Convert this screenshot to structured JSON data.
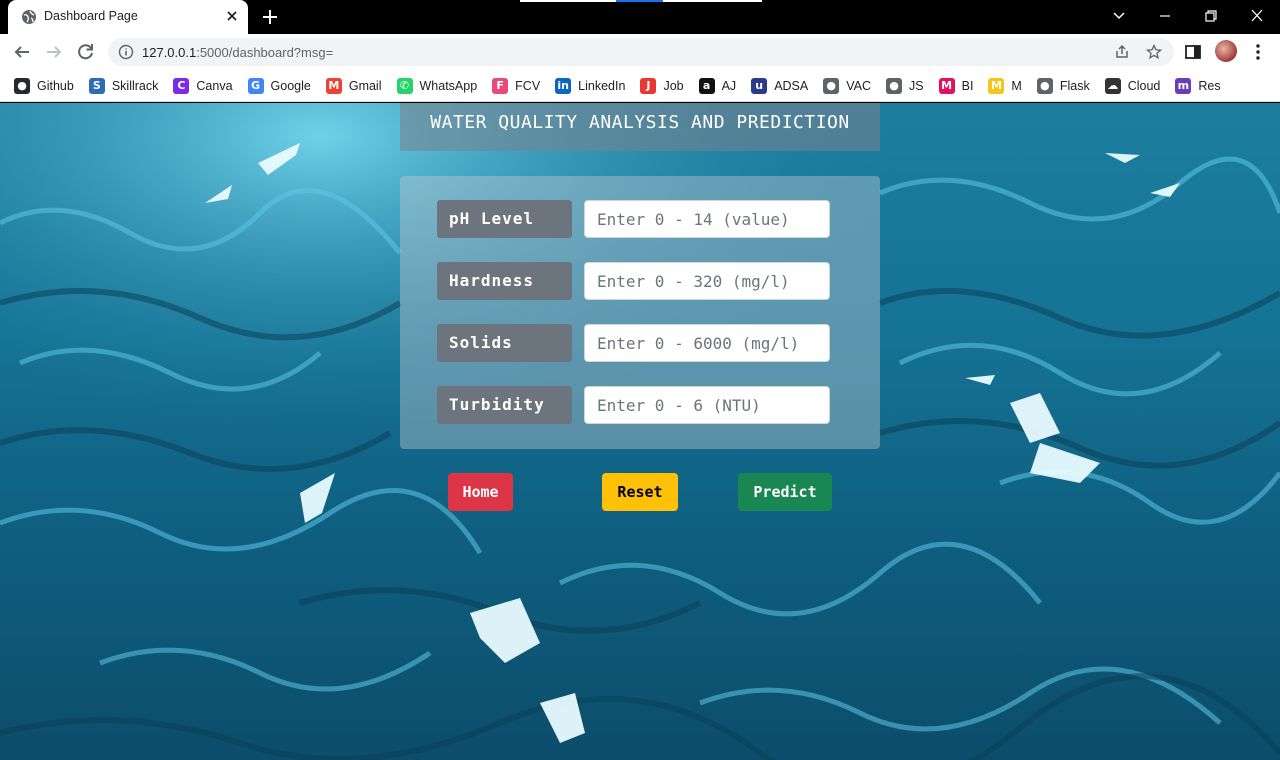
{
  "browser": {
    "tab_title": "Dashboard Page",
    "url_host": "127.0.0.1",
    "url_rest": ":5000/dashboard?msg="
  },
  "bookmarks": [
    {
      "label": "Github",
      "icon": "github-icon",
      "color": "#24292e",
      "glyph": "●"
    },
    {
      "label": "Skillrack",
      "icon": "skillrack-icon",
      "color": "#2d6db5",
      "glyph": "S"
    },
    {
      "label": "Canva",
      "icon": "canva-icon",
      "color": "#7d2ae8",
      "glyph": "C"
    },
    {
      "label": "Google",
      "icon": "google-icon",
      "color": "#4285f4",
      "glyph": "G"
    },
    {
      "label": "Gmail",
      "icon": "gmail-icon",
      "color": "#ea4335",
      "glyph": "M"
    },
    {
      "label": "WhatsApp",
      "icon": "whatsapp-icon",
      "color": "#25d366",
      "glyph": "✆"
    },
    {
      "label": "FCV",
      "icon": "fcv-icon",
      "color": "#e84a7a",
      "glyph": "F"
    },
    {
      "label": "LinkedIn",
      "icon": "linkedin-icon",
      "color": "#0a66c2",
      "glyph": "in"
    },
    {
      "label": "Job",
      "icon": "job-icon",
      "color": "#e53935",
      "glyph": "J"
    },
    {
      "label": "AJ",
      "icon": "amazon-icon",
      "color": "#111111",
      "glyph": "a"
    },
    {
      "label": "ADSA",
      "icon": "ADSA-icon",
      "color": "#2d3a8c",
      "glyph": "u"
    },
    {
      "label": "VAC",
      "icon": "globe-icon",
      "color": "#5f6368",
      "glyph": "●"
    },
    {
      "label": "JS",
      "icon": "globe-icon",
      "color": "#5f6368",
      "glyph": "●"
    },
    {
      "label": "BI",
      "icon": "bi-icon",
      "color": "#e0115f",
      "glyph": "M"
    },
    {
      "label": "M",
      "icon": "m-icon",
      "color": "#f5c518",
      "glyph": "M"
    },
    {
      "label": "Flask",
      "icon": "globe-icon",
      "color": "#5f6368",
      "glyph": "●"
    },
    {
      "label": "Cloud",
      "icon": "cloud-icon",
      "color": "#333333",
      "glyph": "☁"
    },
    {
      "label": "Res",
      "icon": "res-icon",
      "color": "#6a3fb5",
      "glyph": "m"
    }
  ],
  "page": {
    "title": "WATER QUALITY ANALYSIS AND PREDICTION",
    "fields": [
      {
        "label": "pH Level",
        "placeholder": "Enter 0 - 14 (value)"
      },
      {
        "label": "Hardness",
        "placeholder": "Enter 0 - 320 (mg/l)"
      },
      {
        "label": "Solids",
        "placeholder": "Enter 0 - 6000 (mg/l)"
      },
      {
        "label": "Turbidity",
        "placeholder": "Enter 0 - 6 (NTU)"
      }
    ],
    "buttons": {
      "home": "Home",
      "reset": "Reset",
      "predict": "Predict"
    }
  },
  "colors": {
    "home": "#dc3545",
    "reset": "#ffc107",
    "predict": "#198754",
    "label_bg": "#6c757d"
  }
}
